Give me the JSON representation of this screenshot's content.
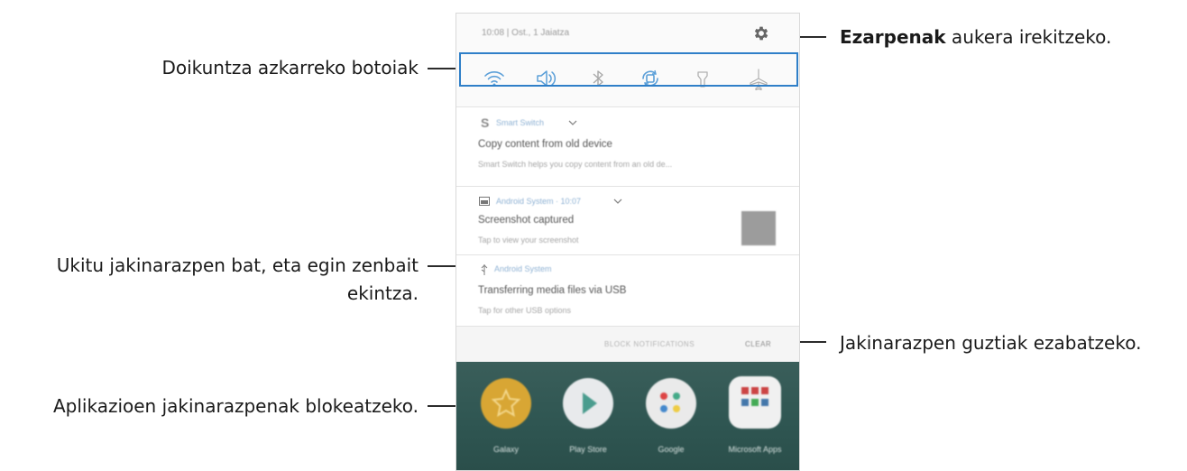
{
  "callouts": {
    "quick_settings": "Doikuntza azkarreko botoiak",
    "settings_bold": "Ezarpenak",
    "settings_rest": " aukera irekitzeko.",
    "notification_line1": "Ukitu jakinarazpen bat, eta egin zenbait",
    "notification_line2": "ekintza.",
    "clear_all": "Jakinarazpen guztiak ezabatzeko.",
    "block": "Aplikazioen jakinarazpenak blokeatzeko."
  },
  "panel": {
    "status_text": "10:08 | Ost., 1 Jaiatza",
    "quick_settings_icons": [
      "wifi-icon",
      "sound-icon",
      "bluetooth-icon",
      "auto-rotate-icon",
      "flashlight-icon",
      "airplane-mode-icon"
    ],
    "notifications": [
      {
        "app": "Smart Switch",
        "title": "Copy content from old device",
        "body": "Smart Switch helps you copy content from an old de..."
      },
      {
        "app": "Android System · 10:07",
        "title": "Screenshot captured",
        "body": "Tap to view your screenshot"
      },
      {
        "app": "Android System",
        "title": "Transferring media files via USB",
        "body": "Tap for other USB options"
      }
    ],
    "block_label": "BLOCK NOTIFICATIONS",
    "clear_label": "CLEAR"
  },
  "home_apps": [
    {
      "label": "Galaxy",
      "color": "#d8a634"
    },
    {
      "label": "Play Store",
      "color": "#e8eaec"
    },
    {
      "label": "Google",
      "color": "#eaeaea"
    },
    {
      "label": "Microsoft Apps",
      "color": "#f0f0f0"
    }
  ],
  "colors": {
    "icon_blue": "#5b9fd8",
    "highlight_border": "#2f7fc8",
    "home_background": "#2f5652"
  }
}
